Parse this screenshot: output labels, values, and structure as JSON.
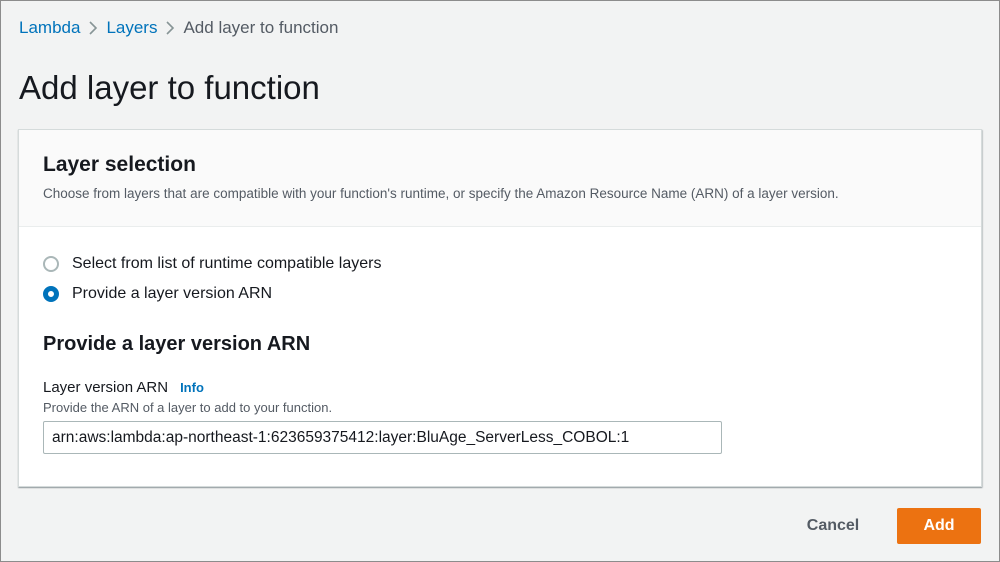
{
  "breadcrumb": {
    "items": [
      {
        "label": "Lambda"
      },
      {
        "label": "Layers"
      },
      {
        "label": "Add layer to function"
      }
    ]
  },
  "page": {
    "title": "Add layer to function"
  },
  "layer_selection": {
    "title": "Layer selection",
    "description": "Choose from layers that are compatible with your function's runtime, or specify the Amazon Resource Name (ARN) of a layer version.",
    "options": [
      {
        "label": "Select from list of runtime compatible layers",
        "selected": false
      },
      {
        "label": "Provide a layer version ARN",
        "selected": true
      }
    ]
  },
  "arn_section": {
    "title": "Provide a layer version ARN",
    "field_label": "Layer version ARN",
    "info_label": "Info",
    "field_description": "Provide the ARN of a layer to add to your function.",
    "value": "arn:aws:lambda:ap-northeast-1:623659375412:layer:BluAge_ServerLess_COBOL:1"
  },
  "actions": {
    "cancel_label": "Cancel",
    "add_label": "Add"
  },
  "colors": {
    "link": "#0073bb",
    "primary_button": "#ec7211",
    "page_background": "#f2f3f3"
  },
  "icons": {
    "breadcrumb_separator": "chevron-right-icon"
  }
}
